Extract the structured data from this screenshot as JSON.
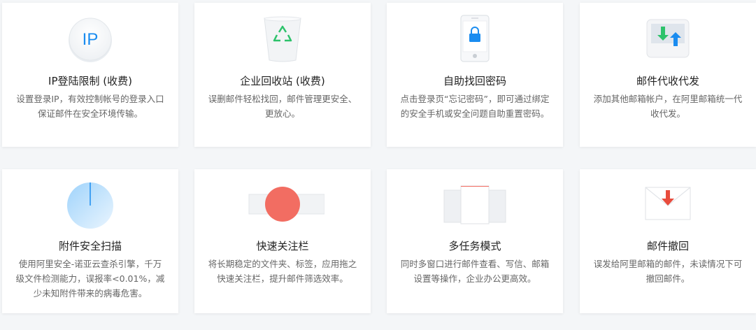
{
  "features": [
    {
      "title": "IP登陆限制 (收费)",
      "desc": "设置登录IP，有效控制帐号的登录入口保证邮件在安全环境传输。",
      "icon": "ip-icon",
      "icon_text": "IP"
    },
    {
      "title": "企业回收站 (收费)",
      "desc": "误删邮件轻松找回，邮件管理更安全、更放心。",
      "icon": "recycle-bin-icon"
    },
    {
      "title": "自助找回密码",
      "desc": "点击登录页“忘记密码”，即可通过绑定的安全手机或安全问题自助重置密码。",
      "icon": "phone-lock-icon"
    },
    {
      "title": "邮件代收代发",
      "desc": "添加其他邮箱帐户，在阿里邮箱统一代收代发。",
      "icon": "mail-transfer-icon"
    },
    {
      "title": "附件安全扫描",
      "desc": "使用阿里安全-诺亚云查杀引擎，千万级文件检测能力，误报率<0.01%，减少未知附件带来的病毒危害。",
      "icon": "scan-icon"
    },
    {
      "title": "快速关注栏",
      "desc": "将长期稳定的文件夹、标签，应用拖之快速关注栏，提升邮件筛选效率。",
      "icon": "quick-focus-icon"
    },
    {
      "title": "多任务模式",
      "desc": "同时多窗口进行邮件查看、写信、邮箱设置等操作，企业办公更高效。",
      "icon": "multitask-icon"
    },
    {
      "title": "邮件撤回",
      "desc": "误发给阿里邮箱的邮件，未读情况下可撤回邮件。",
      "icon": "mail-recall-icon"
    }
  ],
  "colors": {
    "accent_blue": "#1a8cf0",
    "recycle_green": "#2dc26b",
    "recall_red": "#e84c3d",
    "focus_red": "#f26d62"
  }
}
